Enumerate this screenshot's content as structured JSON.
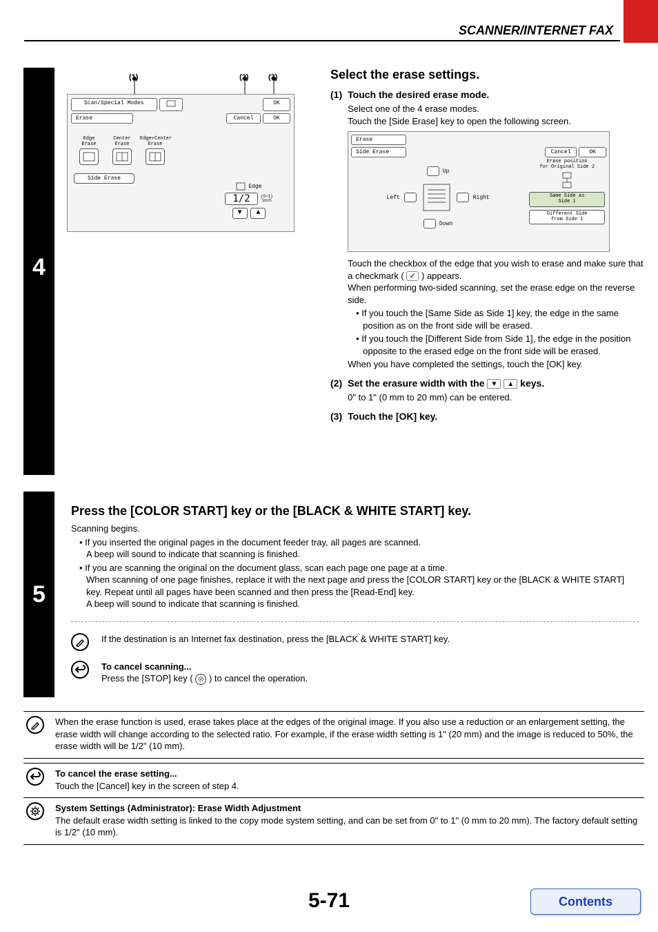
{
  "header": {
    "section_title": "SCANNER/INTERNET FAX"
  },
  "page_number": "5-71",
  "contents_button": "Contents",
  "callouts": {
    "c1": "(1)",
    "c2": "(2)",
    "c3": "(3)"
  },
  "screen1": {
    "title_row1": "Scan/Special Modes",
    "ok": "OK",
    "title_row2": "Erase",
    "cancel": "Cancel",
    "modes": {
      "edge": "Edge\nErase",
      "center": "Center\nErase",
      "edge_center": "Edge+Center\nErase"
    },
    "side_erase": "Side Erase",
    "edge_label": "Edge",
    "edge_value": "1/2",
    "edge_unit": "(0~1)\ninch"
  },
  "screen2": {
    "title1": "Erase",
    "title2": "Side Erase",
    "cancel": "Cancel",
    "ok": "OK",
    "up": "Up",
    "left": "Left",
    "right": "Right",
    "down": "Down",
    "pos_label": "Erase position\nfor Original Side 2",
    "same_side": "Same Side as\nSide 1",
    "diff_side": "Different Side\nfrom Side 1"
  },
  "step4": {
    "num": "4",
    "h": "Select the erase settings.",
    "s1_label": "(1)",
    "s1_h": "Touch the desired erase mode.",
    "s1_p1": "Select one of the 4 erase modes.",
    "s1_p2": "Touch the [Side Erase] key to open the following screen.",
    "s1_p3a": "Touch the checkbox of the edge that you wish to erase and make sure that a checkmark (",
    "s1_p3b": ") appears.",
    "s1_p4": "When performing two-sided scanning, set the erase edge on the reverse side.",
    "s1_b1": "If you touch the [Same Side as Side 1] key, the edge in the same position as on the front side will be erased.",
    "s1_b2": "If you touch the [Different Side from Side 1], the edge in the position opposite to the erased edge on the front side will be erased.",
    "s1_p5": "When you have completed the settings, touch the [OK] key.",
    "s2_label": "(2)",
    "s2_h_a": "Set the erasure width with the ",
    "s2_h_b": " keys.",
    "s2_p": "0\" to 1\" (0 mm to 20 mm) can be entered.",
    "s3_label": "(3)",
    "s3_h": "Touch the [OK] key."
  },
  "step5": {
    "num": "5",
    "h": "Press the [COLOR START] key or the [BLACK & WHITE START] key.",
    "p1": "Scanning begins.",
    "b1a": "If you inserted the original pages in the document feeder tray, all pages are scanned.",
    "b1b": "A beep will sound to indicate that scanning is finished.",
    "b2a": "If you are scanning the original on the document glass, scan each page one page at a time.",
    "b2b": "When scanning of one page finishes, replace it with the next page and press the [COLOR START] key or the [BLACK & WHITE START] key. Repeat until all pages have been scanned and then press the [Read-End] key.",
    "b2c": "A beep will sound to indicate that scanning is finished.",
    "note1": "If the destination is an Internet fax destination, press the [BLACK & WHITE START] key.",
    "cancel_h": "To cancel scanning...",
    "cancel_p_a": "Press the [STOP] key (",
    "cancel_p_b": ") to cancel the operation."
  },
  "info1": "When the erase function is used, erase takes place at the edges of the original image. If you also use a reduction or an enlargement setting, the erase width will change according to the selected ratio. For example, if the erase width setting is 1\" (20 mm) and the image is reduced to 50%, the erase width will be 1/2\" (10 mm).",
  "info2_h": "To cancel the erase setting...",
  "info2_p": "Touch the [Cancel] key in the screen of step 4.",
  "info3_h": "System Settings (Administrator): Erase Width Adjustment",
  "info3_p": "The default erase width setting is linked to the copy mode system setting, and can be set from 0\" to 1\" (0 mm to 20 mm). The factory default setting is 1/2\" (10 mm)."
}
